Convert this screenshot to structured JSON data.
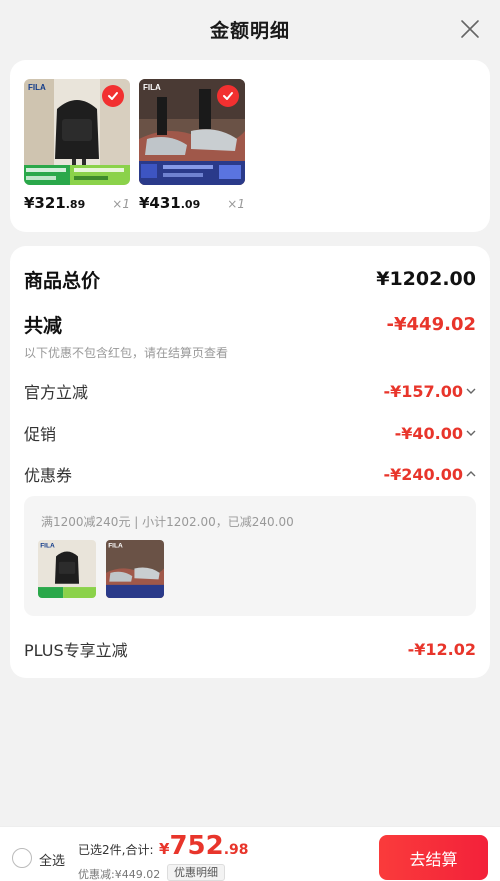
{
  "header": {
    "title": "金额明细"
  },
  "products": [
    {
      "price_main": "¥321",
      "price_dec": ".89",
      "qty": "×1"
    },
    {
      "price_main": "¥431",
      "price_dec": ".09",
      "qty": "×1"
    }
  ],
  "details": {
    "total_label": "商品总价",
    "total_value": "¥1202.00",
    "discount_label": "共减",
    "discount_value": "-¥449.02",
    "note": "以下优惠不包含红包，请在结算页查看",
    "official_label": "官方立减",
    "official_value": "-¥157.00",
    "promo_label": "促销",
    "promo_value": "-¥40.00",
    "coupon_label": "优惠券",
    "coupon_value": "-¥240.00",
    "coupon_desc": "满1200减240元 | 小计1202.00，已减240.00",
    "plus_label": "PLUS专享立减",
    "plus_value": "-¥12.02"
  },
  "bottom": {
    "select_all": "全选",
    "summary": "已选2件,合计:",
    "pay_cur": "¥",
    "pay_int": "752",
    "pay_dec": ".98",
    "saved": "优惠减:¥449.02",
    "detail_tag": "优惠明细",
    "checkout": "去结算"
  },
  "colors": {
    "accent": "#e8352b",
    "check": "#f23030"
  }
}
